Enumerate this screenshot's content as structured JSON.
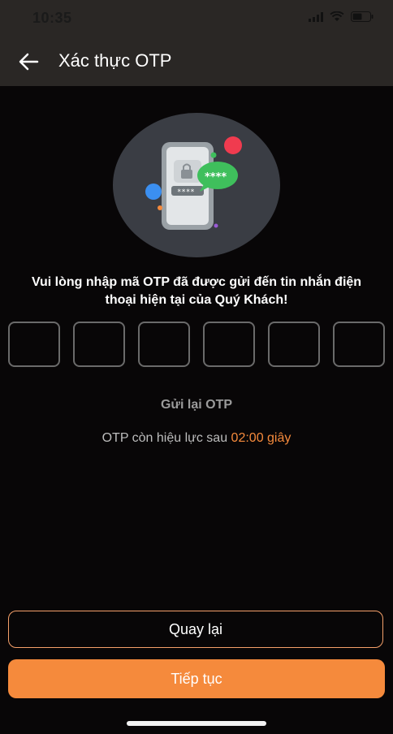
{
  "status_bar": {
    "time": "10:35"
  },
  "header": {
    "title": "Xác thực OTP"
  },
  "illustration": {
    "password_mask": "****"
  },
  "message": "Vui lòng nhập mã OTP đã được gửi đến tin nhắn điện thoại hiện tại của Quý Khách!",
  "otp": {
    "digits": [
      "",
      "",
      "",
      "",
      "",
      ""
    ]
  },
  "resend_label": "Gửi lại OTP",
  "validity": {
    "prefix": "OTP còn hiệu lực sau",
    "countdown": "02:00 giây"
  },
  "buttons": {
    "back": "Quay lại",
    "next": "Tiếp tục"
  },
  "colors": {
    "accent": "#f58a3c",
    "background": "#080607",
    "header": "#2a2725"
  },
  "icons": [
    "back-arrow-icon",
    "signal-icon",
    "wifi-icon",
    "battery-icon",
    "lock-icon",
    "chat-bubble-icon"
  ]
}
